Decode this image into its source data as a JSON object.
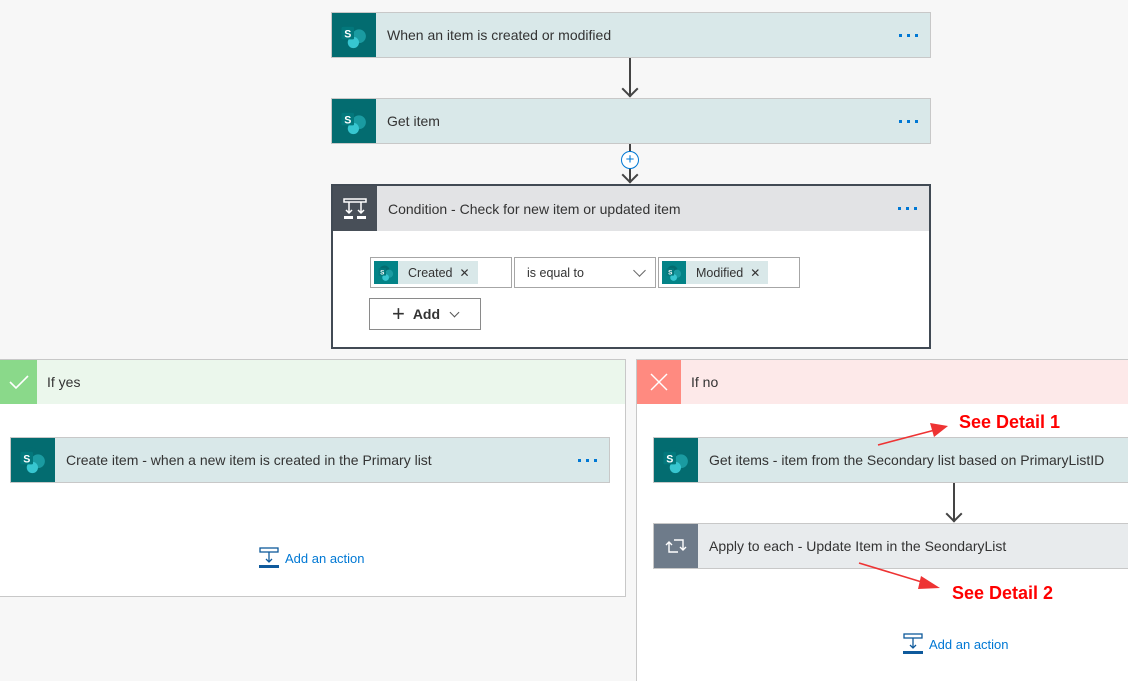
{
  "flow": {
    "trigger": {
      "title": "When an item is created or modified",
      "icon": "sharepoint-icon"
    },
    "get_item": {
      "title": "Get item",
      "icon": "sharepoint-icon"
    },
    "condition": {
      "title": "Condition - Check for new item or updated item",
      "icon": "condition-icon",
      "left_operand": "Created",
      "operator": "is equal to",
      "right_operand": "Modified",
      "add_label": "Add"
    },
    "if_yes": {
      "label": "If yes",
      "color": "#8ad98a",
      "actions": [
        {
          "title": "Create item - when a new item is created in the Primary list",
          "icon": "sharepoint-icon"
        }
      ],
      "add_action_label": "Add an action"
    },
    "if_no": {
      "label": "If no",
      "color": "#ff8a80",
      "actions": [
        {
          "title": "Get items - item from the Secondary list based on PrimaryListID",
          "icon": "sharepoint-icon"
        },
        {
          "title": "Apply to each - Update Item in the SeondaryList",
          "icon": "loop-icon"
        }
      ],
      "add_action_label": "Add an action"
    }
  },
  "annotations": [
    {
      "text": "See Detail 1",
      "color": "#ff0000"
    },
    {
      "text": "See Detail 2",
      "color": "#ff0000"
    }
  ]
}
